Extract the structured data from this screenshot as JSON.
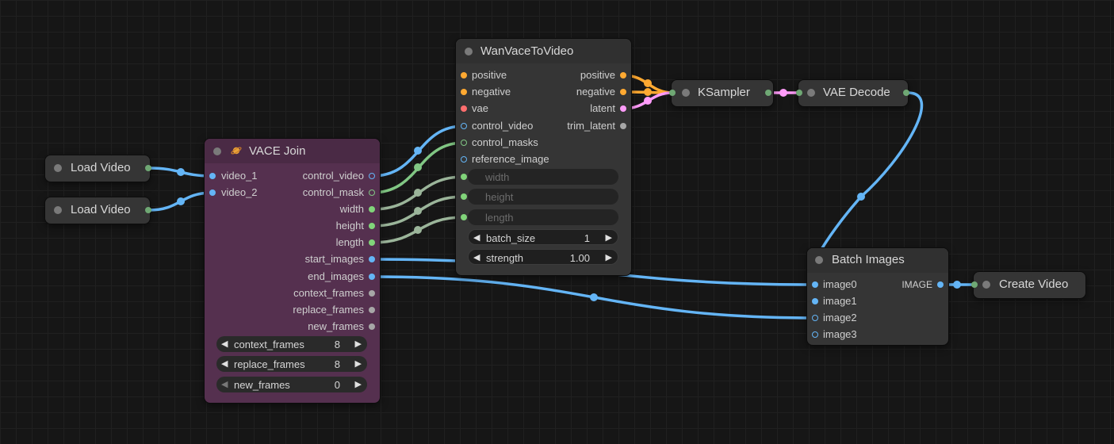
{
  "nodes": {
    "load_video_1": {
      "title": "Load Video"
    },
    "load_video_2": {
      "title": "Load Video"
    },
    "vace_join": {
      "title": "VACE Join",
      "inputs": [
        "video_1",
        "video_2"
      ],
      "outputs": [
        "control_video",
        "control_mask",
        "width",
        "height",
        "length",
        "start_images",
        "end_images",
        "context_frames",
        "replace_frames",
        "new_frames"
      ],
      "widgets": [
        {
          "label": "context_frames",
          "value": "8"
        },
        {
          "label": "replace_frames",
          "value": "8"
        },
        {
          "label": "new_frames",
          "value": "0"
        }
      ]
    },
    "wan_vace": {
      "title": "WanVaceToVideo",
      "inputs": [
        "positive",
        "negative",
        "vae",
        "control_video",
        "control_masks",
        "reference_image"
      ],
      "outputs": [
        "positive",
        "negative",
        "latent",
        "trim_latent"
      ],
      "disabled_widgets": [
        "width",
        "height",
        "length"
      ],
      "widgets": [
        {
          "label": "batch_size",
          "value": "1"
        },
        {
          "label": "strength",
          "value": "1.00"
        }
      ]
    },
    "ksampler": {
      "title": "KSampler"
    },
    "vae_decode": {
      "title": "VAE Decode"
    },
    "batch_images": {
      "title": "Batch Images",
      "inputs": [
        "image0",
        "image1",
        "image2",
        "image3"
      ],
      "output": "IMAGE"
    },
    "create_video": {
      "title": "Create Video"
    }
  },
  "colors": {
    "image": "#64b5f6",
    "mask": "#81c784",
    "int": "#9bb59a",
    "conditioning": "#ffa931",
    "latent": "#ff9cf9",
    "vae": "#ff6e6e",
    "generic": "#a7a7a7",
    "vace_bg": "#55304f",
    "node_bg": "#353535"
  }
}
